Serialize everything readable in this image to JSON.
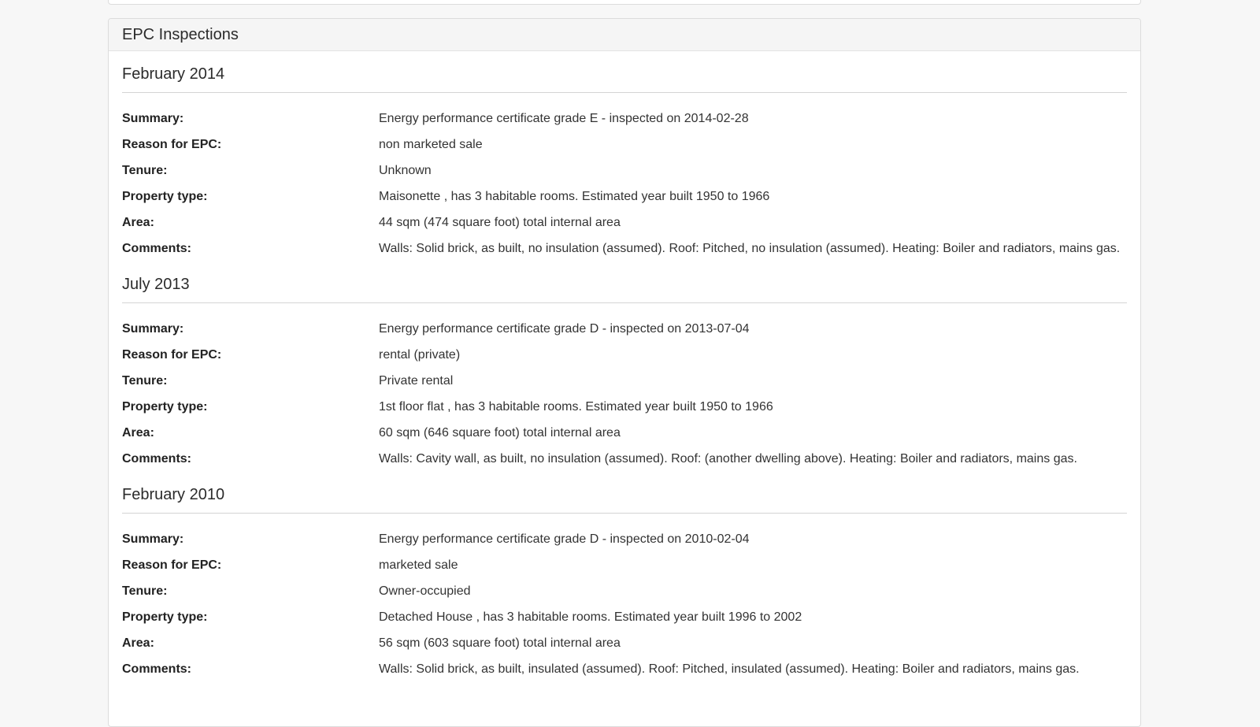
{
  "panel": {
    "title": "EPC Inspections"
  },
  "labels": {
    "summary": "Summary:",
    "reason": "Reason for EPC:",
    "tenure": "Tenure:",
    "property_type": "Property type:",
    "area": "Area:",
    "comments": "Comments:"
  },
  "inspections": [
    {
      "title": "February 2014",
      "summary": "Energy performance certificate grade E - inspected on 2014-02-28",
      "reason": "non marketed sale",
      "tenure": "Unknown",
      "property_type": "Maisonette , has 3 habitable rooms. Estimated year built 1950 to 1966",
      "area": "44 sqm (474 square foot) total internal area",
      "comments": "Walls: Solid brick, as built, no insulation (assumed). Roof: Pitched, no insulation (assumed). Heating: Boiler and radiators, mains gas."
    },
    {
      "title": "July 2013",
      "summary": "Energy performance certificate grade D - inspected on 2013-07-04",
      "reason": "rental (private)",
      "tenure": "Private rental",
      "property_type": "1st floor flat , has 3 habitable rooms. Estimated year built 1950 to 1966",
      "area": "60 sqm (646 square foot) total internal area",
      "comments": "Walls: Cavity wall, as built, no insulation (assumed). Roof: (another dwelling above). Heating: Boiler and radiators, mains gas."
    },
    {
      "title": "February 2010",
      "summary": "Energy performance certificate grade D - inspected on 2010-02-04",
      "reason": "marketed sale",
      "tenure": "Owner-occupied",
      "property_type": "Detached House , has 3 habitable rooms. Estimated year built 1996 to 2002",
      "area": "56 sqm (603 square foot) total internal area",
      "comments": "Walls: Solid brick, as built, insulated (assumed). Roof: Pitched, insulated (assumed). Heating: Boiler and radiators, mains gas."
    }
  ]
}
